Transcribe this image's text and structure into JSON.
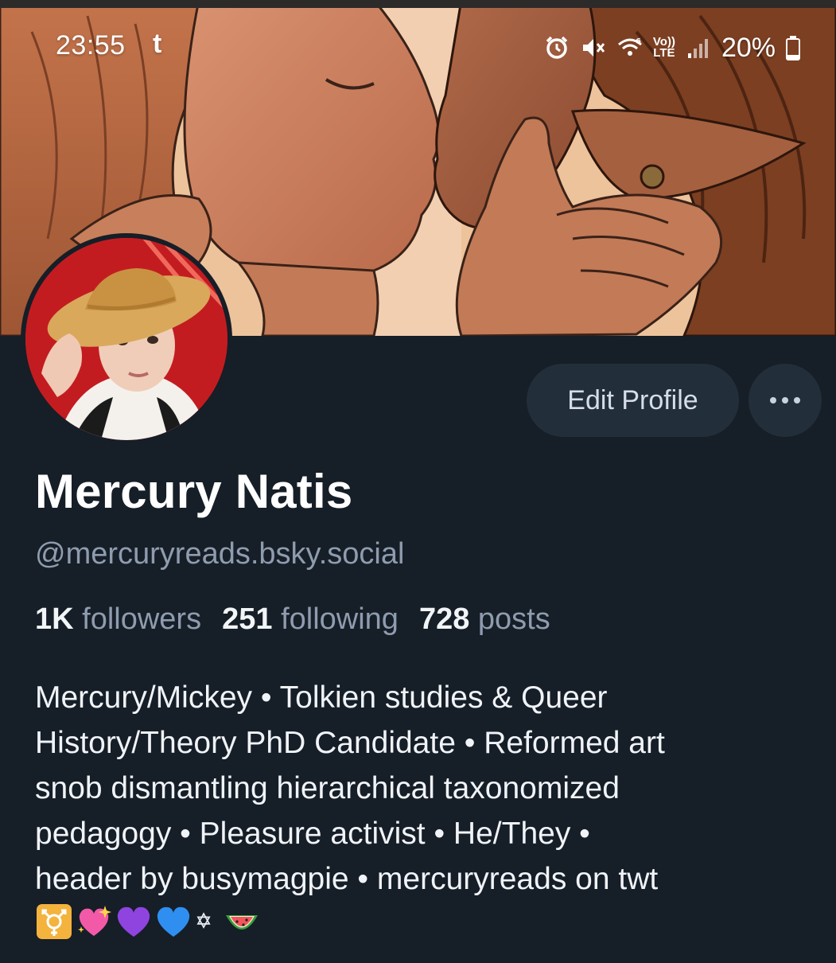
{
  "status_bar": {
    "time": "23:55",
    "app_indicator": "t",
    "battery_percent": "20%",
    "network_label_top": "Vo))",
    "network_label_bottom": "LTE",
    "icons": [
      "alarm-icon",
      "mute-icon",
      "wifi-6-icon",
      "volte-icon",
      "signal-icon",
      "battery-icon"
    ]
  },
  "profile": {
    "display_name": "Mercury Natis",
    "handle": "@mercuryreads.bsky.social",
    "stats": {
      "followers_count": "1K",
      "followers_label": "followers",
      "following_count": "251",
      "following_label": "following",
      "posts_count": "728",
      "posts_label": "posts"
    },
    "bio_lines": [
      "Mercury/Mickey • Tolkien studies & Queer",
      "History/Theory PhD Candidate • Reformed art",
      "snob dismantling hierarchical taxonomized",
      "pedagogy • Pleasure activist • He/They •",
      "header by busymagpie •  mercuryreads on twt"
    ],
    "bio_emojis": [
      "transgender-symbol-emoji",
      "sparkling-heart-emoji",
      "purple-heart-emoji",
      "blue-heart-emoji",
      "star-of-david-emoji",
      "watermelon-emoji"
    ]
  },
  "actions": {
    "edit_profile_label": "Edit Profile",
    "more_icon": "ellipsis-icon"
  },
  "colors": {
    "background": "#161e27",
    "button_bg": "#232e3b",
    "secondary_text": "#8f9caf",
    "primary_text": "#ffffff"
  }
}
